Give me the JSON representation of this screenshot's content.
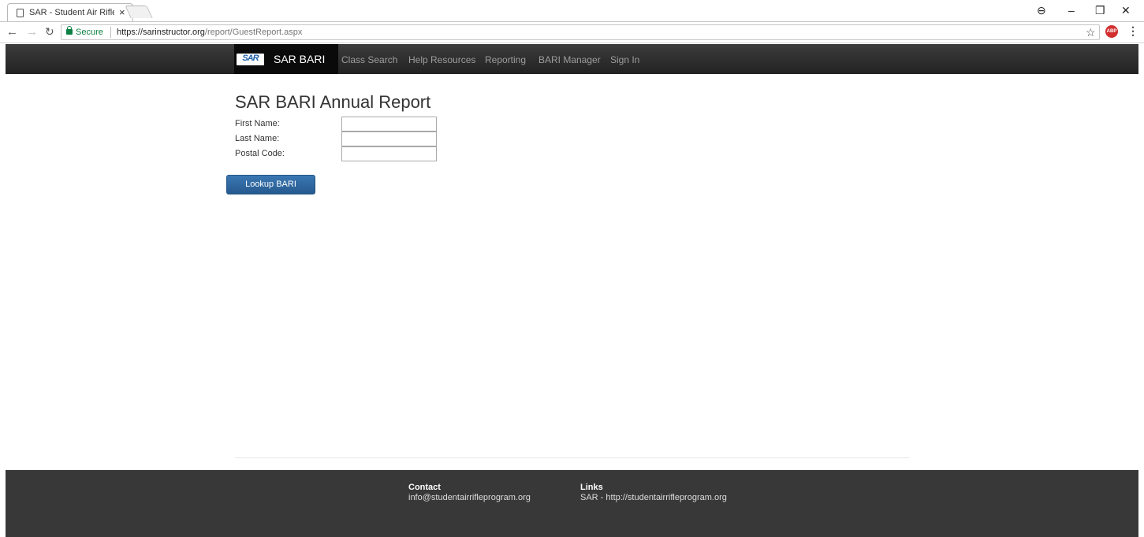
{
  "browser": {
    "tab_title": "SAR - Student Air Riflery",
    "tab_close": "×",
    "secure_label": "Secure",
    "url_host": "https://sarinstructor.org",
    "url_path": "/report/GuestReport.aspx",
    "abp_label": "ABP"
  },
  "navbar": {
    "logo_text": "SAR",
    "brand": "SAR BARI",
    "links": [
      "Class Search",
      "Help Resources",
      "Reporting",
      "BARI Manager",
      "Sign In"
    ]
  },
  "main": {
    "title": "SAR BARI Annual Report",
    "fields": [
      {
        "label": "First Name:",
        "value": ""
      },
      {
        "label": "Last Name:",
        "value": ""
      },
      {
        "label": "Postal Code:",
        "value": ""
      }
    ],
    "button_label": "Lookup BARI"
  },
  "footer": {
    "contact_heading": "Contact",
    "contact_email": "info@studentairrifleprogram.org",
    "links_heading": "Links",
    "links_text": "SAR - http://studentairrifleprogram.org"
  },
  "colors": {
    "navbar_bg": "#222222",
    "button_bg": "#2d6ca2",
    "footer_bg": "#383838",
    "secure_green": "#0b8043"
  }
}
